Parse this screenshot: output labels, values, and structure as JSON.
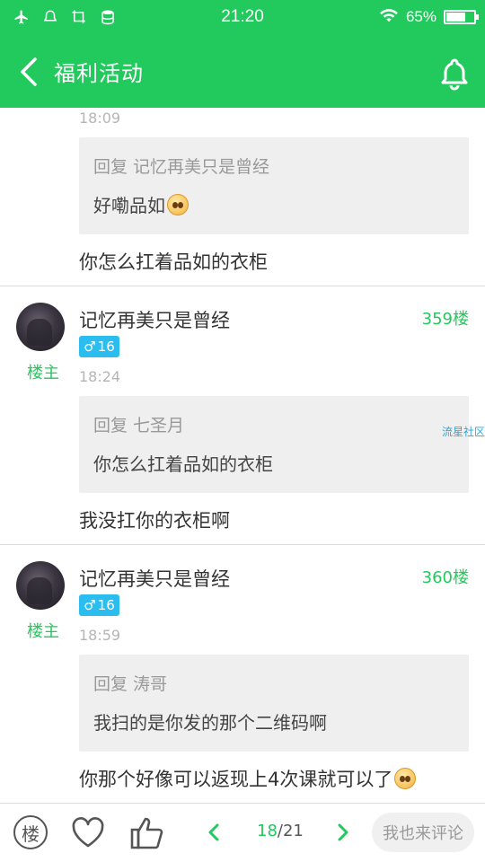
{
  "status_bar": {
    "time": "21:20",
    "battery_percent": "65%",
    "battery_level": 0.65,
    "icons": [
      "airplane-icon",
      "app-icon",
      "screenshot-icon",
      "storage-icon",
      "wifi-icon",
      "battery-icon"
    ]
  },
  "app_bar": {
    "title": "福利活动",
    "back_icon": "back-arrow-icon",
    "bell_icon": "bell-icon"
  },
  "top_partial": {
    "time": "18:09",
    "quote_header": "回复 记忆再美只是曾经",
    "quote_body": "好嘞品如",
    "message": "你怎么扛着品如的衣柜"
  },
  "posts": [
    {
      "username": "记忆再美只是曾经",
      "owner_label": "楼主",
      "floor": "359楼",
      "gender_level": "16",
      "gender_symbol": "♂",
      "time": "18:24",
      "quote_header": "回复 七圣月",
      "quote_body": "你怎么扛着品如的衣柜",
      "message": "我没扛你的衣柜啊"
    },
    {
      "username": "记忆再美只是曾经",
      "owner_label": "楼主",
      "floor": "360楼",
      "gender_level": "16",
      "gender_symbol": "♂",
      "time": "18:59",
      "quote_header": "回复 涛哥",
      "quote_body": "我扫的是你发的那个二维码啊",
      "message": "你那个好像可以返现上4次课就可以了"
    }
  ],
  "watermark": "流星社区",
  "bottom_bar": {
    "floor_button": "楼",
    "page_current": "18",
    "page_total": "/21",
    "comment_placeholder": "我也来评论",
    "accent": "#22c95c"
  },
  "colors": {
    "brand_green": "#22c95c",
    "gender_badge": "#2bbcf0"
  }
}
